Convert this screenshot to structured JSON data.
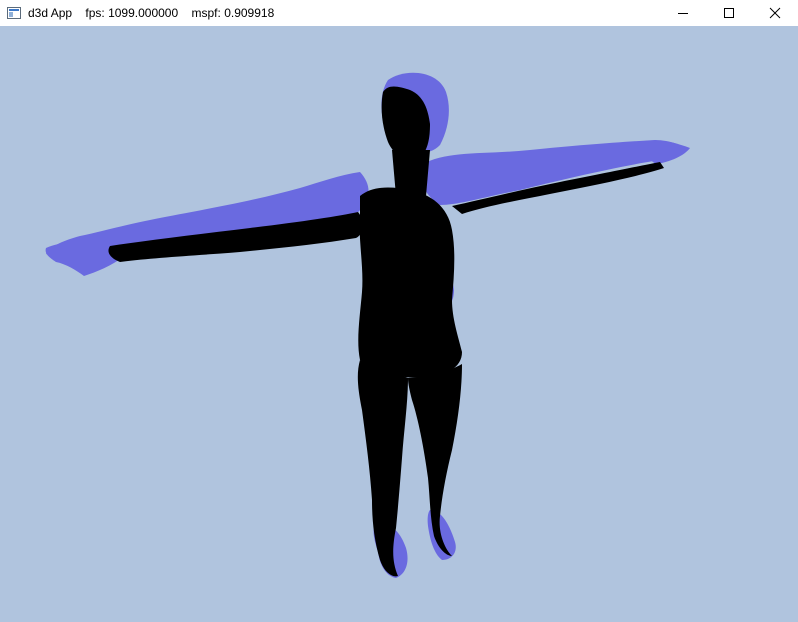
{
  "window": {
    "title": "d3d App",
    "fps_label": "fps:",
    "fps_value": "1099.000000",
    "mspf_label": "mspf:",
    "mspf_value": "0.909918"
  },
  "icons": {
    "app": "window-app-icon",
    "minimize": "minimize-icon",
    "maximize": "maximize-icon",
    "close": "close-icon"
  },
  "colors": {
    "clear_color": "#b0c4de",
    "mesh_lit": "#6a6ae0",
    "mesh_shadow": "#000000",
    "titlebar": "#ffffff"
  }
}
